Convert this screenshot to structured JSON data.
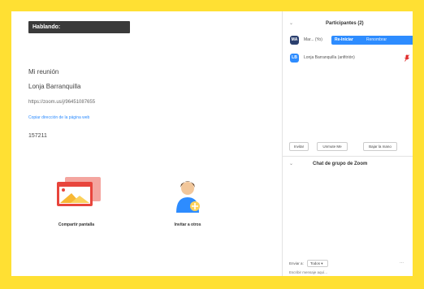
{
  "app": {
    "speaking_label": "Hablando:"
  },
  "meeting": {
    "name": "Mi reunión",
    "host": "Lonja Barranquilla",
    "url": "https://zoom.us/j/96451087655",
    "copy_link": "Copiar dirección de la página web",
    "participant_id": "157211"
  },
  "actions": {
    "share_label": "Compartir pantalla",
    "invite_label": "Invitar a otros"
  },
  "participants": {
    "title": "Participantes (2)",
    "list": [
      {
        "initials": "MA",
        "name": "Mar... (Yo)",
        "color": "#2a3f6e"
      },
      {
        "initials": "LB",
        "name": "Lonja Barranquilla (anfitrión)",
        "color": "#2d8cff"
      }
    ],
    "rename_button": "Re-Iniciar",
    "rename_hint": "Renombrar",
    "buttons": {
      "invite": "Invitar",
      "unmute": "Unmute Me",
      "lower_hand": "Bajar la mano"
    }
  },
  "chat": {
    "title": "Chat de grupo de Zoom",
    "send_to_label": "Enviar a:",
    "recipient": "Todos ▾",
    "more": "...",
    "input_placeholder": "Escribir mensaje aquí..."
  },
  "colors": {
    "border_yellow": "#ffe033",
    "accent_blue": "#2d8cff",
    "dark_header": "#3a3a3a",
    "share_red": "#e8453c",
    "muted_red": "#e02828"
  }
}
